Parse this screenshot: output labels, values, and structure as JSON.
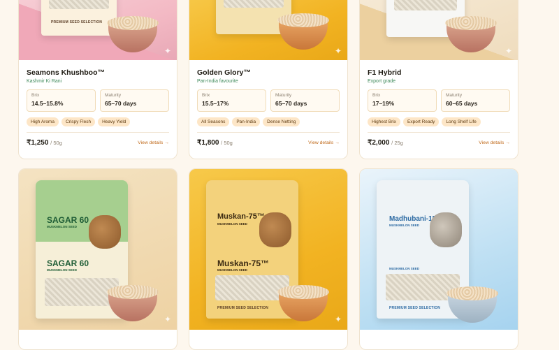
{
  "products": [
    {
      "title": "Seamons Khushboo™",
      "subtitle": "Kashmir Ki Rani",
      "pack_tagline": "PREMIUM SEED SELECTION",
      "stats": [
        {
          "label": "Brix",
          "value": "14.5–15.8%"
        },
        {
          "label": "Maturity",
          "value": "65–70 days"
        }
      ],
      "tags": [
        "High Aroma",
        "Crispy Flesh",
        "Heavy Yield"
      ],
      "price": "₹1,250",
      "unit": "/ 50g",
      "details_label": "View details →"
    },
    {
      "title": "Golden Glory™",
      "subtitle": "Pan-India favourite",
      "stats": [
        {
          "label": "Brix",
          "value": "15.5–17%"
        },
        {
          "label": "Maturity",
          "value": "65–70 days"
        }
      ],
      "tags": [
        "All Seasons",
        "Pan-India",
        "Dense Netting"
      ],
      "price": "₹1,800",
      "unit": "/ 50g",
      "details_label": "View details →"
    },
    {
      "title": "F1 Hybrid",
      "subtitle": "Export grade",
      "stats": [
        {
          "label": "Brix",
          "value": "17–19%"
        },
        {
          "label": "Maturity",
          "value": "60–65 days"
        }
      ],
      "tags": [
        "Highest Brix",
        "Export Ready",
        "Long Shelf Life"
      ],
      "price": "₹2,000",
      "unit": "/ 25g",
      "details_label": "View details →"
    },
    {
      "pack_brand": "SAGAR 60",
      "pack_sub": "MUSKMELON SEED",
      "pack_brand_lower": "SAGAR 60",
      "pack_sub_lower": "MUSKMELON SEED"
    },
    {
      "pack_brand": "Muskan-75™",
      "pack_sub": "MUSKMELON SEED",
      "pack_brand_lower": "Muskan-75™",
      "pack_sub_lower": "MUSKMELON SEED",
      "pack_tagline": "PREMIUM SEED SELECTION"
    },
    {
      "pack_brand": "Madhubani-151",
      "pack_sub": "MUSKMELON SEED",
      "pack_sub_lower": "MUSKMELON SEED",
      "pack_tagline": "PREMIUM SEED SELECTION"
    }
  ],
  "colors": {
    "accent": "#c06a1b",
    "subtitle_green": "#3f8a5b",
    "tag_bg": "#fde6c7"
  },
  "icons": {
    "sparkle": "sparkle-icon"
  }
}
